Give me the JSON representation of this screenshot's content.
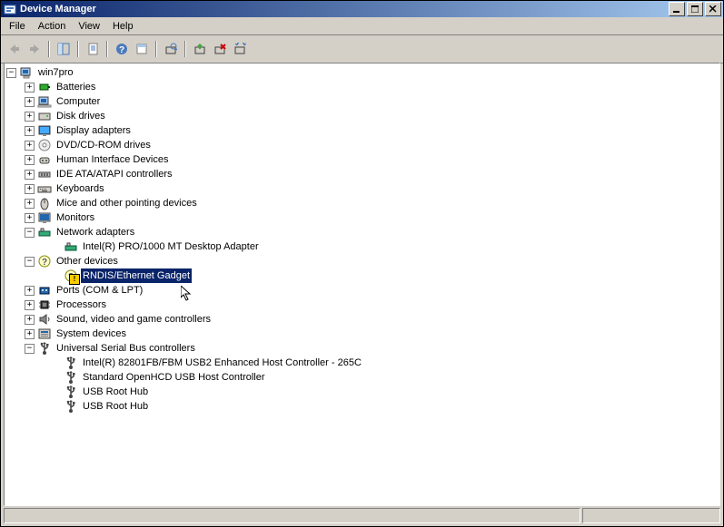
{
  "window": {
    "title": "Device Manager"
  },
  "menu": {
    "file": "File",
    "action": "Action",
    "view": "View",
    "help": "Help"
  },
  "tree": {
    "root": "win7pro",
    "categories": [
      {
        "label": "Batteries",
        "icon": "battery"
      },
      {
        "label": "Computer",
        "icon": "computer"
      },
      {
        "label": "Disk drives",
        "icon": "disk"
      },
      {
        "label": "Display adapters",
        "icon": "display"
      },
      {
        "label": "DVD/CD-ROM drives",
        "icon": "dvd"
      },
      {
        "label": "Human Interface Devices",
        "icon": "hid"
      },
      {
        "label": "IDE ATA/ATAPI controllers",
        "icon": "ide"
      },
      {
        "label": "Keyboards",
        "icon": "keyboard"
      },
      {
        "label": "Mice and other pointing devices",
        "icon": "mouse"
      },
      {
        "label": "Monitors",
        "icon": "monitor"
      },
      {
        "label": "Network adapters",
        "icon": "network",
        "expanded": true,
        "children": [
          {
            "label": "Intel(R) PRO/1000 MT Desktop Adapter",
            "icon": "network"
          }
        ]
      },
      {
        "label": "Other devices",
        "icon": "other",
        "expanded": true,
        "children": [
          {
            "label": "RNDIS/Ethernet Gadget",
            "icon": "other",
            "warning": true,
            "selected": true
          }
        ]
      },
      {
        "label": "Ports (COM & LPT)",
        "icon": "ports"
      },
      {
        "label": "Processors",
        "icon": "processor"
      },
      {
        "label": "Sound, video and game controllers",
        "icon": "sound"
      },
      {
        "label": "System devices",
        "icon": "system"
      },
      {
        "label": "Universal Serial Bus controllers",
        "icon": "usb",
        "expanded": true,
        "children": [
          {
            "label": "Intel(R) 82801FB/FBM USB2 Enhanced Host Controller - 265C",
            "icon": "usb"
          },
          {
            "label": "Standard OpenHCD USB Host Controller",
            "icon": "usb"
          },
          {
            "label": "USB Root Hub",
            "icon": "usb"
          },
          {
            "label": "USB Root Hub",
            "icon": "usb"
          }
        ]
      }
    ]
  }
}
